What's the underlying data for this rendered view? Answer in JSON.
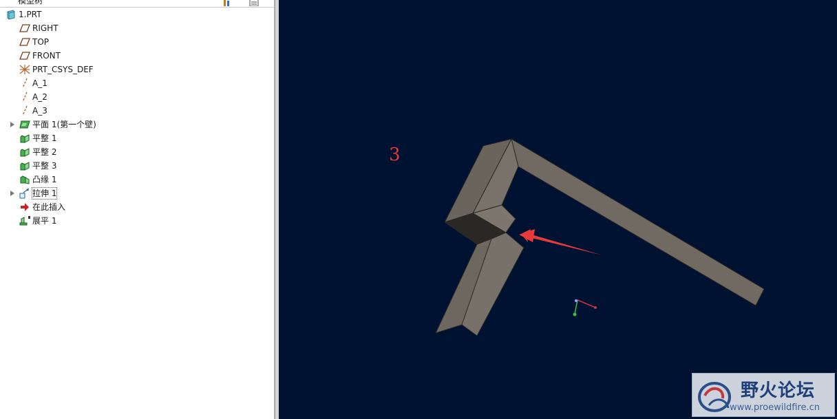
{
  "panel": {
    "title": "模型树"
  },
  "tree": [
    {
      "label": "1.PRT",
      "icon": "part-icon",
      "expandable": false
    },
    {
      "label": "RIGHT",
      "icon": "datum-plane-icon",
      "expandable": false
    },
    {
      "label": "TOP",
      "icon": "datum-plane-icon",
      "expandable": false
    },
    {
      "label": "FRONT",
      "icon": "datum-plane-icon",
      "expandable": false
    },
    {
      "label": "PRT_CSYS_DEF",
      "icon": "coordinate-system-icon",
      "expandable": false
    },
    {
      "label": "A_1",
      "icon": "datum-axis-icon",
      "expandable": false
    },
    {
      "label": "A_2",
      "icon": "datum-axis-icon",
      "expandable": false
    },
    {
      "label": "A_3",
      "icon": "datum-axis-icon",
      "expandable": false
    },
    {
      "label": "平面 1(第一个壁)",
      "icon": "sheetmetal-wall-icon",
      "expandable": true
    },
    {
      "label": "平整 1",
      "icon": "flat-wall-icon",
      "expandable": false
    },
    {
      "label": "平整 2",
      "icon": "flat-wall-icon",
      "expandable": false
    },
    {
      "label": "平整 3",
      "icon": "flat-wall-icon",
      "expandable": false
    },
    {
      "label": "凸缘 1",
      "icon": "flange-icon",
      "expandable": false
    },
    {
      "label": "拉伸 1",
      "icon": "extrude-icon",
      "expandable": true
    },
    {
      "label": "在此插入",
      "icon": "insert-here-arrow-icon",
      "expandable": false
    },
    {
      "label": "展平 1",
      "icon": "unbend-icon",
      "expandable": false
    }
  ],
  "viewport": {
    "annotation": "3",
    "background": "#001232",
    "model_color": "#6f6a63",
    "arrow_color": "#e83a3a"
  },
  "watermark": {
    "title": "野火论坛",
    "url": "www.proewildfire.cn"
  }
}
